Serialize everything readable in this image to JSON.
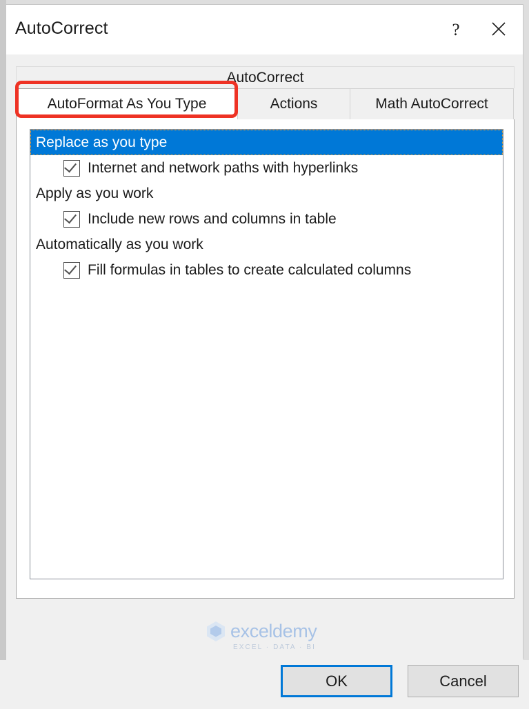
{
  "window": {
    "title": "AutoCorrect",
    "help_icon": "help-question-icon",
    "help_label": "?",
    "close_icon": "close-x-icon"
  },
  "tabs": {
    "top_row_label": "AutoCorrect",
    "items": [
      {
        "label": "AutoFormat As You Type",
        "active": true
      },
      {
        "label": "Actions",
        "active": false
      },
      {
        "label": "Math AutoCorrect",
        "active": false
      }
    ]
  },
  "list": {
    "rows": [
      {
        "kind": "group",
        "label": "Replace as you type",
        "selected": true
      },
      {
        "kind": "option",
        "label": "Internet and network paths with hyperlinks",
        "checked": true
      },
      {
        "kind": "group",
        "label": "Apply as you work",
        "selected": false
      },
      {
        "kind": "option",
        "label": "Include new rows and columns in table",
        "checked": true
      },
      {
        "kind": "group",
        "label": "Automatically as you work",
        "selected": false
      },
      {
        "kind": "option",
        "label": "Fill formulas in tables to create calculated columns",
        "checked": true
      }
    ]
  },
  "footer": {
    "ok_label": "OK",
    "cancel_label": "Cancel"
  },
  "watermark": {
    "brand": "exceldemy",
    "tagline": "EXCEL · DATA · BI"
  },
  "colors": {
    "selection_blue": "#0078d7",
    "focus_blue": "#0078d7",
    "annotation_red": "#ee3224",
    "dialog_bg": "#f0f0f0",
    "panel_bg": "#ffffff"
  }
}
